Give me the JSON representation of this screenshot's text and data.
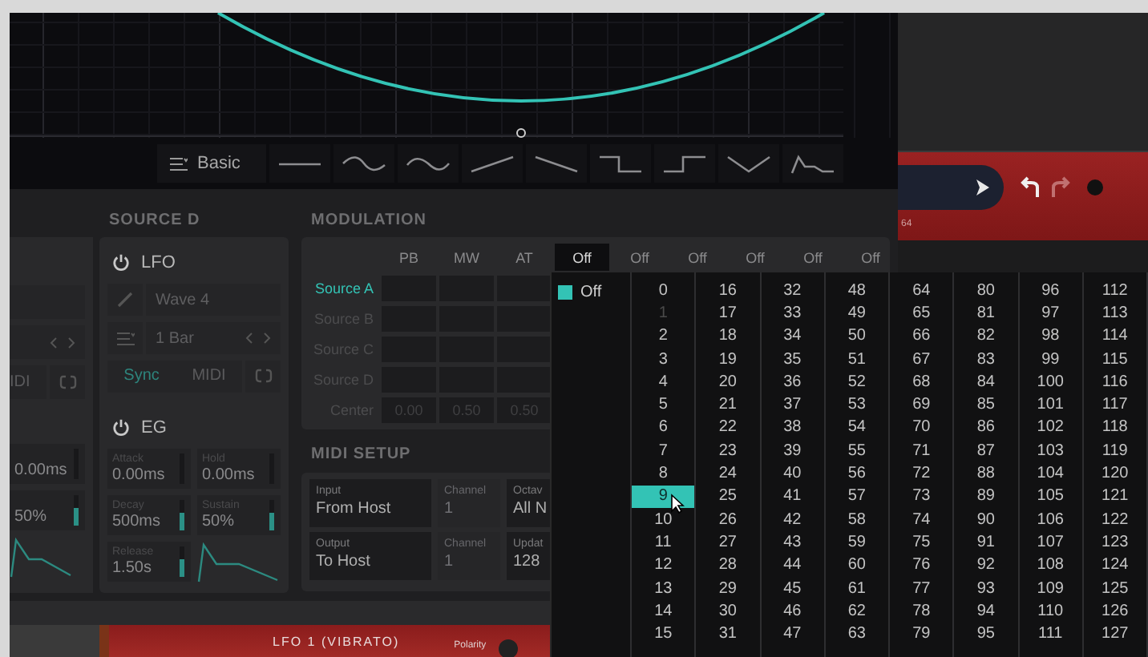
{
  "editor": {
    "preset": "Basic",
    "shapes": [
      {
        "kind": "flat"
      },
      {
        "kind": "sine"
      },
      {
        "kind": "sine_inverted"
      },
      {
        "kind": "ramp_up"
      },
      {
        "kind": "ramp_down"
      },
      {
        "kind": "step_down"
      },
      {
        "kind": "step_up"
      },
      {
        "kind": "triangle"
      },
      {
        "kind": "decay"
      }
    ]
  },
  "transport": {
    "counter": "64"
  },
  "source_c_partial": {
    "midi_label": "IDI",
    "params": [
      {
        "value": "0.00ms"
      },
      {
        "value": "50%",
        "level": 0.6
      }
    ]
  },
  "source_d": {
    "title": "SOURCE D",
    "lfo": {
      "label": "LFO",
      "wave": "Wave 4",
      "rate": "1 Bar",
      "sync": {
        "label": "Sync",
        "selected": true
      },
      "midi": {
        "label": "MIDI",
        "selected": false
      }
    },
    "eg": {
      "label": "EG",
      "params": [
        {
          "label": "Attack",
          "value": "0.00ms"
        },
        {
          "label": "Hold",
          "value": "0.00ms"
        },
        {
          "label": "Decay",
          "value": "500ms",
          "level": 0.6
        },
        {
          "label": "Sustain",
          "value": "50%",
          "level": 0.6
        },
        {
          "label": "Release",
          "value": "1.50s",
          "level": 0.6
        }
      ]
    }
  },
  "modulation": {
    "title": "MODULATION",
    "columns": [
      {
        "label": "PB",
        "open": false
      },
      {
        "label": "MW",
        "open": false
      },
      {
        "label": "AT",
        "open": false
      },
      {
        "label": "Off",
        "open": true
      },
      {
        "label": "Off",
        "open": false
      },
      {
        "label": "Off",
        "open": false
      },
      {
        "label": "Off",
        "open": false
      },
      {
        "label": "Off",
        "open": false
      },
      {
        "label": "Off",
        "open": false
      }
    ],
    "rows": [
      {
        "label": "Source A",
        "selected": true
      },
      {
        "label": "Source B",
        "selected": false
      },
      {
        "label": "Source C",
        "selected": false
      },
      {
        "label": "Source D",
        "selected": false
      }
    ],
    "center": {
      "label": "Center",
      "values": [
        "0.00",
        "0.50",
        "0.50"
      ]
    }
  },
  "midi_setup": {
    "title": "MIDI SETUP",
    "rows": [
      [
        {
          "label": "Input",
          "value": "From Host",
          "disabled": false
        },
        {
          "label": "Channel",
          "value": "1",
          "disabled": true
        },
        {
          "label": "Octav",
          "value": "All N",
          "disabled": false
        }
      ],
      [
        {
          "label": "Output",
          "value": "To Host",
          "disabled": false
        },
        {
          "label": "Channel",
          "value": "1",
          "disabled": true
        },
        {
          "label": "Updat",
          "value": "128",
          "disabled": false
        }
      ]
    ]
  },
  "channel_menu": {
    "off": {
      "label": "Off",
      "checked": true
    },
    "options": [
      {
        "label": "0",
        "selected": false,
        "disabled": false
      },
      {
        "label": "1",
        "selected": false,
        "disabled": true
      },
      {
        "label": "2",
        "selected": false,
        "disabled": false
      },
      {
        "label": "3",
        "selected": false,
        "disabled": false
      },
      {
        "label": "4",
        "selected": false,
        "disabled": false
      },
      {
        "label": "5",
        "selected": false,
        "disabled": false
      },
      {
        "label": "6",
        "selected": false,
        "disabled": false
      },
      {
        "label": "7",
        "selected": false,
        "disabled": false
      },
      {
        "label": "8",
        "selected": false,
        "disabled": false
      },
      {
        "label": "9",
        "selected": true,
        "disabled": false
      },
      {
        "label": "10",
        "selected": false,
        "disabled": false
      },
      {
        "label": "11",
        "selected": false,
        "disabled": false
      },
      {
        "label": "12",
        "selected": false,
        "disabled": false
      },
      {
        "label": "13",
        "selected": false,
        "disabled": false
      },
      {
        "label": "14",
        "selected": false,
        "disabled": false
      },
      {
        "label": "15",
        "selected": false,
        "disabled": false
      },
      {
        "label": "16",
        "selected": false,
        "disabled": false
      },
      {
        "label": "17",
        "selected": false,
        "disabled": false
      },
      {
        "label": "18",
        "selected": false,
        "disabled": false
      },
      {
        "label": "19",
        "selected": false,
        "disabled": false
      },
      {
        "label": "20",
        "selected": false,
        "disabled": false
      },
      {
        "label": "21",
        "selected": false,
        "disabled": false
      },
      {
        "label": "22",
        "selected": false,
        "disabled": false
      },
      {
        "label": "23",
        "selected": false,
        "disabled": false
      },
      {
        "label": "24",
        "selected": false,
        "disabled": false
      },
      {
        "label": "25",
        "selected": false,
        "disabled": false
      },
      {
        "label": "26",
        "selected": false,
        "disabled": false
      },
      {
        "label": "27",
        "selected": false,
        "disabled": false
      },
      {
        "label": "28",
        "selected": false,
        "disabled": false
      },
      {
        "label": "29",
        "selected": false,
        "disabled": false
      },
      {
        "label": "30",
        "selected": false,
        "disabled": false
      },
      {
        "label": "31",
        "selected": false,
        "disabled": false
      },
      {
        "label": "32",
        "selected": false,
        "disabled": false
      },
      {
        "label": "33",
        "selected": false,
        "disabled": false
      },
      {
        "label": "34",
        "selected": false,
        "disabled": false
      },
      {
        "label": "35",
        "selected": false,
        "disabled": false
      },
      {
        "label": "36",
        "selected": false,
        "disabled": false
      },
      {
        "label": "37",
        "selected": false,
        "disabled": false
      },
      {
        "label": "38",
        "selected": false,
        "disabled": false
      },
      {
        "label": "39",
        "selected": false,
        "disabled": false
      },
      {
        "label": "40",
        "selected": false,
        "disabled": false
      },
      {
        "label": "41",
        "selected": false,
        "disabled": false
      },
      {
        "label": "42",
        "selected": false,
        "disabled": false
      },
      {
        "label": "43",
        "selected": false,
        "disabled": false
      },
      {
        "label": "44",
        "selected": false,
        "disabled": false
      },
      {
        "label": "45",
        "selected": false,
        "disabled": false
      },
      {
        "label": "46",
        "selected": false,
        "disabled": false
      },
      {
        "label": "47",
        "selected": false,
        "disabled": false
      },
      {
        "label": "48",
        "selected": false,
        "disabled": false
      },
      {
        "label": "49",
        "selected": false,
        "disabled": false
      },
      {
        "label": "50",
        "selected": false,
        "disabled": false
      },
      {
        "label": "51",
        "selected": false,
        "disabled": false
      },
      {
        "label": "52",
        "selected": false,
        "disabled": false
      },
      {
        "label": "53",
        "selected": false,
        "disabled": false
      },
      {
        "label": "54",
        "selected": false,
        "disabled": false
      },
      {
        "label": "55",
        "selected": false,
        "disabled": false
      },
      {
        "label": "56",
        "selected": false,
        "disabled": false
      },
      {
        "label": "57",
        "selected": false,
        "disabled": false
      },
      {
        "label": "58",
        "selected": false,
        "disabled": false
      },
      {
        "label": "59",
        "selected": false,
        "disabled": false
      },
      {
        "label": "60",
        "selected": false,
        "disabled": false
      },
      {
        "label": "61",
        "selected": false,
        "disabled": false
      },
      {
        "label": "62",
        "selected": false,
        "disabled": false
      },
      {
        "label": "63",
        "selected": false,
        "disabled": false
      },
      {
        "label": "64",
        "selected": false,
        "disabled": false
      },
      {
        "label": "65",
        "selected": false,
        "disabled": false
      },
      {
        "label": "66",
        "selected": false,
        "disabled": false
      },
      {
        "label": "67",
        "selected": false,
        "disabled": false
      },
      {
        "label": "68",
        "selected": false,
        "disabled": false
      },
      {
        "label": "69",
        "selected": false,
        "disabled": false
      },
      {
        "label": "70",
        "selected": false,
        "disabled": false
      },
      {
        "label": "71",
        "selected": false,
        "disabled": false
      },
      {
        "label": "72",
        "selected": false,
        "disabled": false
      },
      {
        "label": "73",
        "selected": false,
        "disabled": false
      },
      {
        "label": "74",
        "selected": false,
        "disabled": false
      },
      {
        "label": "75",
        "selected": false,
        "disabled": false
      },
      {
        "label": "76",
        "selected": false,
        "disabled": false
      },
      {
        "label": "77",
        "selected": false,
        "disabled": false
      },
      {
        "label": "78",
        "selected": false,
        "disabled": false
      },
      {
        "label": "79",
        "selected": false,
        "disabled": false
      },
      {
        "label": "80",
        "selected": false,
        "disabled": false
      },
      {
        "label": "81",
        "selected": false,
        "disabled": false
      },
      {
        "label": "82",
        "selected": false,
        "disabled": false
      },
      {
        "label": "83",
        "selected": false,
        "disabled": false
      },
      {
        "label": "84",
        "selected": false,
        "disabled": false
      },
      {
        "label": "85",
        "selected": false,
        "disabled": false
      },
      {
        "label": "86",
        "selected": false,
        "disabled": false
      },
      {
        "label": "87",
        "selected": false,
        "disabled": false
      },
      {
        "label": "88",
        "selected": false,
        "disabled": false
      },
      {
        "label": "89",
        "selected": false,
        "disabled": false
      },
      {
        "label": "90",
        "selected": false,
        "disabled": false
      },
      {
        "label": "91",
        "selected": false,
        "disabled": false
      },
      {
        "label": "92",
        "selected": false,
        "disabled": false
      },
      {
        "label": "93",
        "selected": false,
        "disabled": false
      },
      {
        "label": "94",
        "selected": false,
        "disabled": false
      },
      {
        "label": "95",
        "selected": false,
        "disabled": false
      },
      {
        "label": "96",
        "selected": false,
        "disabled": false
      },
      {
        "label": "97",
        "selected": false,
        "disabled": false
      },
      {
        "label": "98",
        "selected": false,
        "disabled": false
      },
      {
        "label": "99",
        "selected": false,
        "disabled": false
      },
      {
        "label": "100",
        "selected": false,
        "disabled": false
      },
      {
        "label": "101",
        "selected": false,
        "disabled": false
      },
      {
        "label": "102",
        "selected": false,
        "disabled": false
      },
      {
        "label": "103",
        "selected": false,
        "disabled": false
      },
      {
        "label": "104",
        "selected": false,
        "disabled": false
      },
      {
        "label": "105",
        "selected": false,
        "disabled": false
      },
      {
        "label": "106",
        "selected": false,
        "disabled": false
      },
      {
        "label": "107",
        "selected": false,
        "disabled": false
      },
      {
        "label": "108",
        "selected": false,
        "disabled": false
      },
      {
        "label": "109",
        "selected": false,
        "disabled": false
      },
      {
        "label": "110",
        "selected": false,
        "disabled": false
      },
      {
        "label": "111",
        "selected": false,
        "disabled": false
      },
      {
        "label": "112",
        "selected": false,
        "disabled": false
      },
      {
        "label": "113",
        "selected": false,
        "disabled": false
      },
      {
        "label": "114",
        "selected": false,
        "disabled": false
      },
      {
        "label": "115",
        "selected": false,
        "disabled": false
      },
      {
        "label": "116",
        "selected": false,
        "disabled": false
      },
      {
        "label": "117",
        "selected": false,
        "disabled": false
      },
      {
        "label": "118",
        "selected": false,
        "disabled": false
      },
      {
        "label": "119",
        "selected": false,
        "disabled": false
      },
      {
        "label": "120",
        "selected": false,
        "disabled": false
      },
      {
        "label": "121",
        "selected": false,
        "disabled": false
      },
      {
        "label": "122",
        "selected": false,
        "disabled": false
      },
      {
        "label": "123",
        "selected": false,
        "disabled": false
      },
      {
        "label": "124",
        "selected": false,
        "disabled": false
      },
      {
        "label": "125",
        "selected": false,
        "disabled": false
      },
      {
        "label": "126",
        "selected": false,
        "disabled": false
      },
      {
        "label": "127",
        "selected": false,
        "disabled": false
      }
    ]
  },
  "bottom_module": {
    "title": "LFO 1 (VIBRATO)",
    "knob_label": "Polarity"
  }
}
